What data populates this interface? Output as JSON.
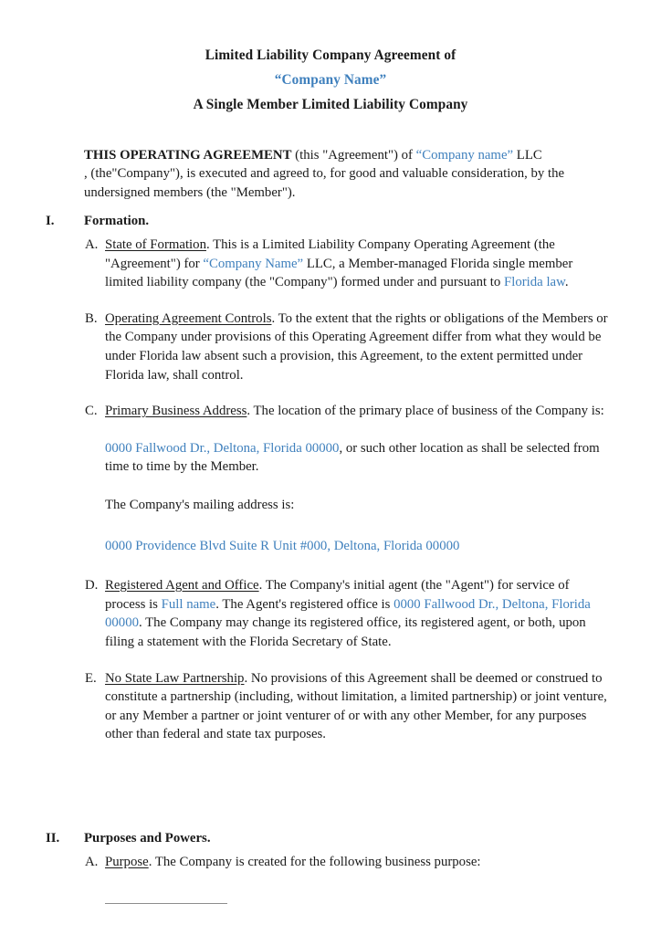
{
  "document": {
    "title_lines": [
      "Limited Liability Company Agreement of",
      "“Company Name”",
      "A Single Member Limited Liability Company"
    ],
    "intro": {
      "lead": "THIS OPERATING AGREEMENT",
      "part1": " (this \"Agreement\") of ",
      "company": "“Company name”",
      "part2": " LLC",
      "part3": ", (the\"Company\"), is executed and agreed to, for good and valuable consideration, by the undersigned members (the \"Member\")."
    },
    "articles": [
      {
        "numeral": "I.",
        "heading": "Formation.",
        "clauses": [
          {
            "letter": "A.",
            "title": "State of Formation",
            "seg1": ". This is a Limited Liability Company Operating Agreement (the \"Agreement\") for ",
            "blue1": "“Company Name”",
            "seg2": " LLC, a Member-managed Florida single member limited liability company (the \"Company\") formed under and pursuant to ",
            "blue2": "Florida law",
            "seg3": "."
          },
          {
            "letter": "B.",
            "title": "Operating Agreement Controls",
            "seg1": ". To the extent that the rights or obligations of the Members or the Company under provisions of this Operating Agreement differ from what they would be under Florida law absent such a provision, this Agreement, to the extent permitted under Florida law, shall control."
          },
          {
            "letter": "C.",
            "title": "Primary Business Address",
            "seg1": ". The location of the primary place of business of the Company is:",
            "address_blue": "0000 Fallwood Dr., Deltona, Florida 00000",
            "address_rest": ", or such other location as shall be selected from time to time by the Member.",
            "mailing_label": "The Company's mailing address is:",
            "mailing_blue": "0000 Providence Blvd Suite R Unit #000, Deltona, Florida 00000"
          },
          {
            "letter": "D.",
            "title": "Registered Agent and Office",
            "seg1": ". The Company's initial agent (the \"Agent\") for service of process is ",
            "blue1": "Full name",
            "seg2": ". The Agent's registered office is ",
            "blue2": "0000 Fallwood Dr., Deltona, Florida 00000",
            "seg3": ". The Company may change its registered office, its registered agent, or both, upon filing a statement with the Florida Secretary of State."
          },
          {
            "letter": "E.",
            "title": "No State Law Partnership",
            "seg1": ". No provisions of this Agreement shall be deemed or construed to constitute a partnership (including, without limitation, a limited partnership) or joint venture, or any Member a partner or joint venturer of or with any other Member, for any purposes other than federal and state tax purposes."
          }
        ]
      },
      {
        "numeral": "II.",
        "heading": "Purposes and Powers.",
        "clauses": [
          {
            "letter": "A.",
            "title": "Purpose",
            "seg1": ". The Company is created for the following business purpose:"
          }
        ]
      }
    ],
    "colors": {
      "accent_blue": "#3f80bd",
      "body_text": "#1a1a1a",
      "rule_gray": "#8d8d8d"
    }
  }
}
